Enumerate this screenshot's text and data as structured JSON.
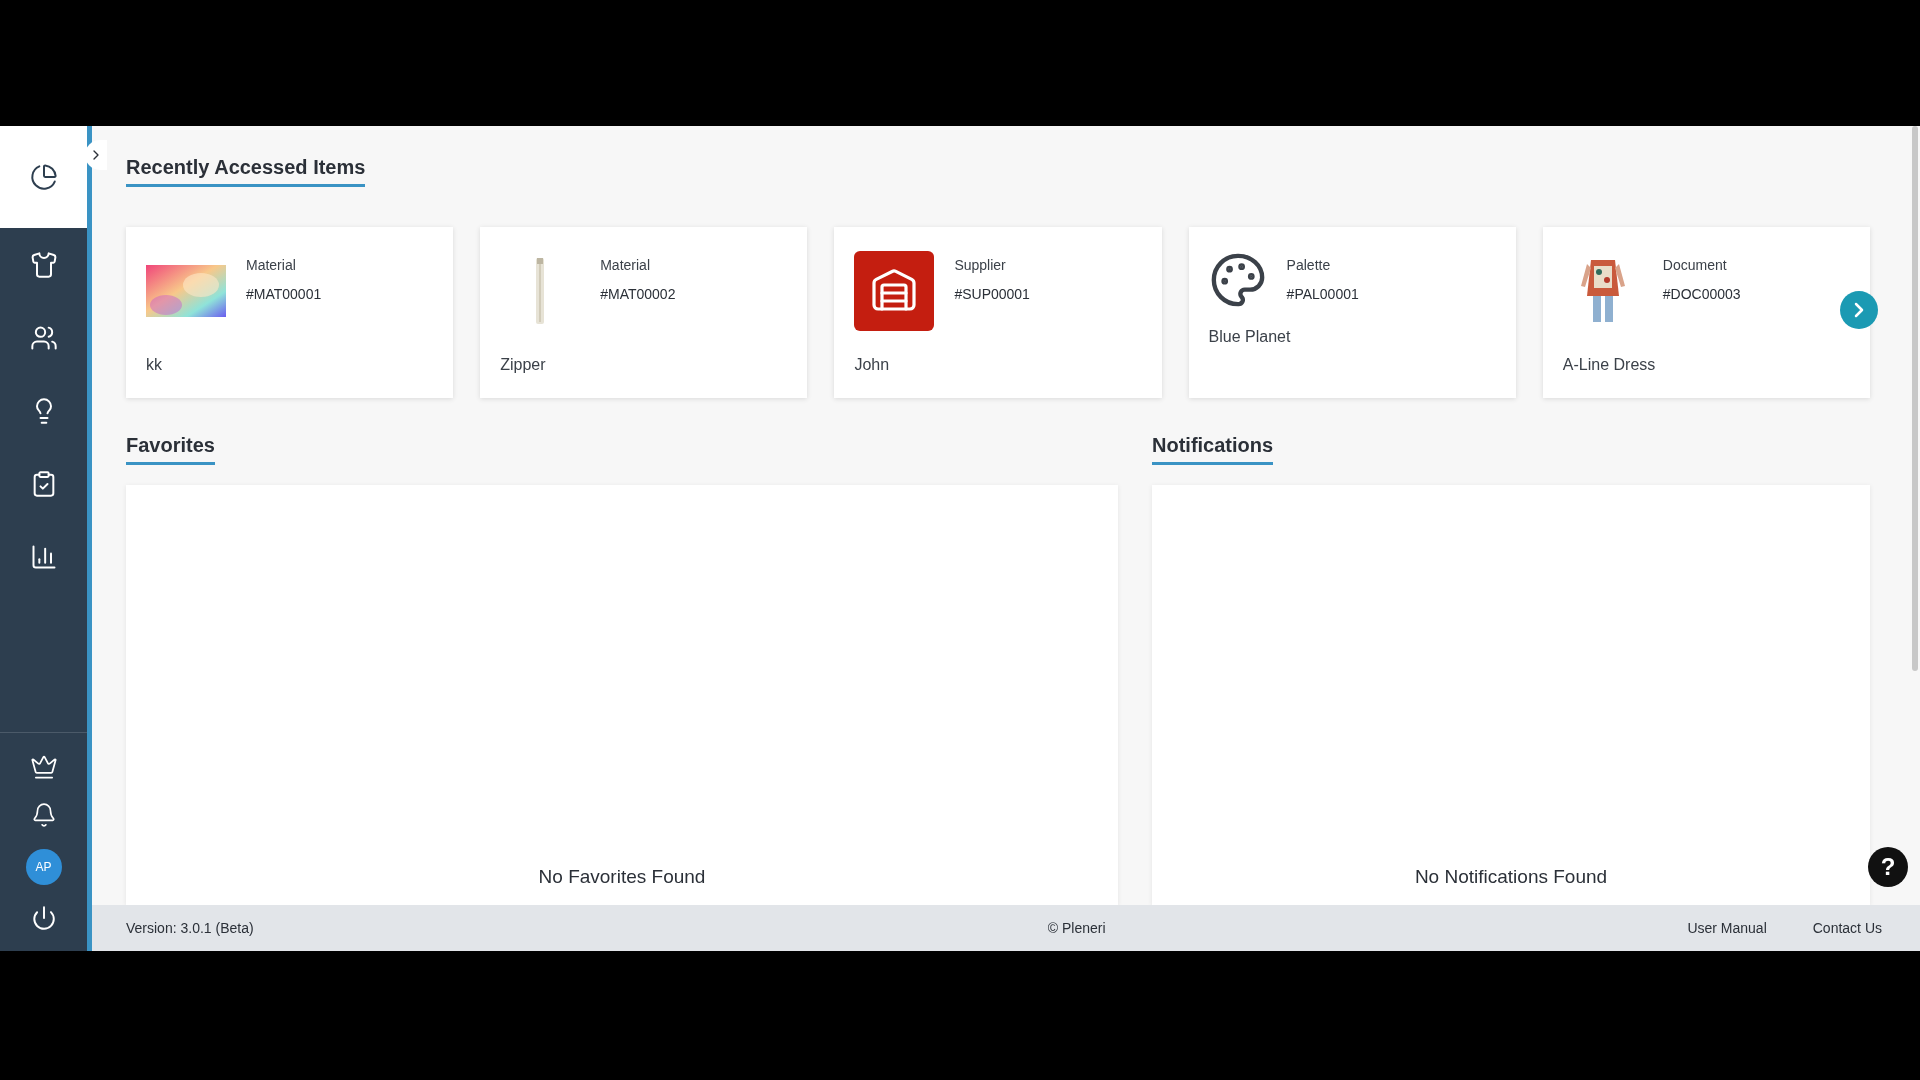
{
  "sidebar": {
    "items": [
      {
        "selected": true
      },
      {
        "selected": false
      },
      {
        "selected": false
      },
      {
        "selected": false
      },
      {
        "selected": false
      },
      {
        "selected": false
      }
    ],
    "user_avatar": {
      "initials": "AP"
    }
  },
  "recent": {
    "title": "Recently Accessed Items",
    "cards": [
      {
        "kind": "picture",
        "type": "Material",
        "code": "#MAT00001",
        "name": "kk"
      },
      {
        "kind": "picture",
        "type": "Material",
        "code": "#MAT00002",
        "name": "Zipper"
      },
      {
        "kind": "supplier",
        "type": "Supplier",
        "code": "#SUP00001",
        "name": "John"
      },
      {
        "kind": "palette",
        "type": "Palette",
        "code": "#PAL00001",
        "name": "Blue Planet"
      },
      {
        "kind": "picture",
        "type": "Document",
        "code": "#DOC00003",
        "name": "A-Line Dress"
      }
    ]
  },
  "favorites": {
    "title": "Favorites",
    "empty_text": "No Favorites Found"
  },
  "notifications": {
    "title": "Notifications",
    "empty_text": "No Notifications Found"
  },
  "help_button": {
    "label": "?"
  },
  "footer": {
    "version": "Version: 3.0.1 (Beta)",
    "copyright": "© Pleneri",
    "links": [
      "User Manual",
      "Contact Us"
    ]
  }
}
